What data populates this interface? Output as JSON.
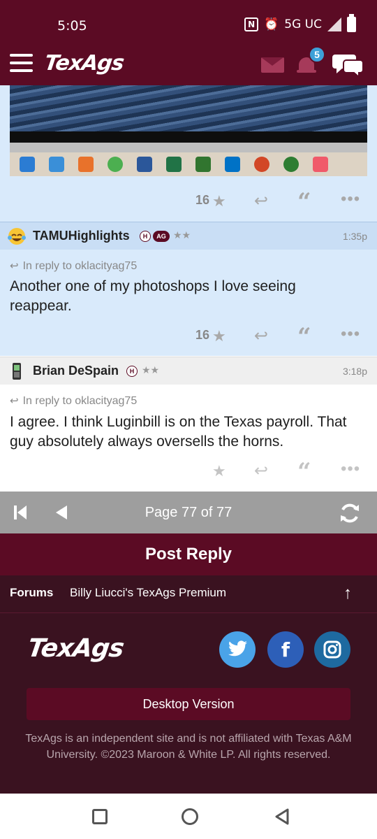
{
  "status_bar": {
    "time": "5:05",
    "network": "5G UC",
    "icons": [
      "nfc-icon",
      "alarm-icon",
      "signal-icon",
      "battery-icon"
    ]
  },
  "app_bar": {
    "logo": "TexAgs",
    "notification_count": "5"
  },
  "posts": [
    {
      "vote_count": "16"
    },
    {
      "username": "TAMUHighlights",
      "badges": [
        "H",
        "AG"
      ],
      "rank": "★★",
      "time": "1:35p",
      "in_reply_to": "In reply to oklacityag75",
      "text": "Another one of my photoshops I love seeing reappear.",
      "vote_count": "16"
    },
    {
      "username": "Brian DeSpain",
      "badges": [
        "H"
      ],
      "rank": "★★",
      "time": "3:18p",
      "in_reply_to": "In reply to oklacityag75",
      "text": "I agree. I think Luginbill is on the Texas payroll. That guy absolutely always oversells the horns.",
      "vote_count": ""
    }
  ],
  "pager": {
    "label": "Page 77 of 77"
  },
  "post_reply": {
    "label": "Post Reply"
  },
  "breadcrumb": {
    "forums": "Forums",
    "board": "Billy Liucci's TexAgs Premium"
  },
  "footer": {
    "logo": "TexAgs",
    "desktop_button": "Desktop Version",
    "disclaimer": "TexAgs is an independent site and is not affiliated with Texas A&M University. ©2023 Maroon & White LP. All rights reserved."
  },
  "colors": {
    "maroon": "#5b0b24",
    "dark_maroon": "#3a1220",
    "reply_blue": "#d9eafb",
    "badge_blue": "#3da0d8",
    "twitter": "#4aa3e8",
    "facebook": "#2d5fb8",
    "instagram": "#1e6aa0"
  }
}
